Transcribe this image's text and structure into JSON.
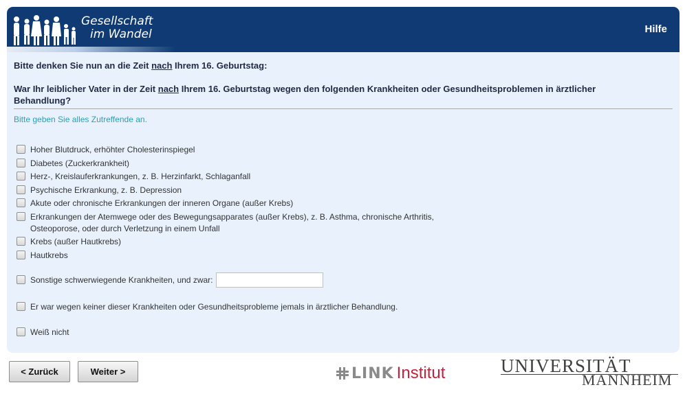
{
  "header": {
    "logo_line1": "Gesellschaft",
    "logo_line2": "im Wandel",
    "help_label": "Hilfe"
  },
  "intro": {
    "before": "Bitte denken Sie nun an die Zeit ",
    "emph": "nach",
    "after": " Ihrem 16. Geburtstag:"
  },
  "question": {
    "before": "War Ihr leiblicher Vater in der Zeit ",
    "emph": "nach",
    "after": " Ihrem 16. Geburtstag wegen den folgenden Krankheiten oder Gesundheitsproblemen in ärztlicher Behandlung?"
  },
  "instruction": "Bitte geben Sie alles Zutreffende an.",
  "options": [
    {
      "label": "Hoher Blutdruck, erhöhter Cholesterinspiegel",
      "checked": false
    },
    {
      "label": "Diabetes (Zuckerkrankheit)",
      "checked": false
    },
    {
      "label": "Herz-, Kreislauferkrankungen, z. B. Herzinfarkt, Schlaganfall",
      "checked": false
    },
    {
      "label": "Psychische Erkrankung, z. B. Depression",
      "checked": false
    },
    {
      "label": "Akute oder chronische Erkrankungen der inneren Organe (außer Krebs)",
      "checked": false
    },
    {
      "label": "Erkrankungen der Atemwege oder des Bewegungsapparates (außer Krebs), z. B. Asthma, chronische Arthritis, Osteoporose, oder durch Verletzung in einem Unfall",
      "checked": false
    },
    {
      "label": "Krebs (außer Hautkrebs)",
      "checked": false
    },
    {
      "label": "Hautkrebs",
      "checked": false
    },
    {
      "label": "Sonstige schwerwiegende Krankheiten, und zwar:",
      "checked": false,
      "input_value": ""
    },
    {
      "label": "Er war wegen keiner dieser Krankheiten oder Gesundheitsprobleme jemals in ärztlicher Behandlung.",
      "checked": false
    },
    {
      "label": "Weiß nicht",
      "checked": false
    }
  ],
  "nav": {
    "back_label": "< Zurück",
    "next_label": "Weiter >"
  },
  "logos": {
    "link_word": "LINK",
    "institut_word": "Institut",
    "uni_line1": "UNIVERSITÄT",
    "uni_line2": "MANNHEIM"
  },
  "colors": {
    "header_bg": "#0f3a73",
    "panel_bg": "#e8f1fc",
    "instruction": "#2aa0b5",
    "institut_red": "#c4233c"
  }
}
